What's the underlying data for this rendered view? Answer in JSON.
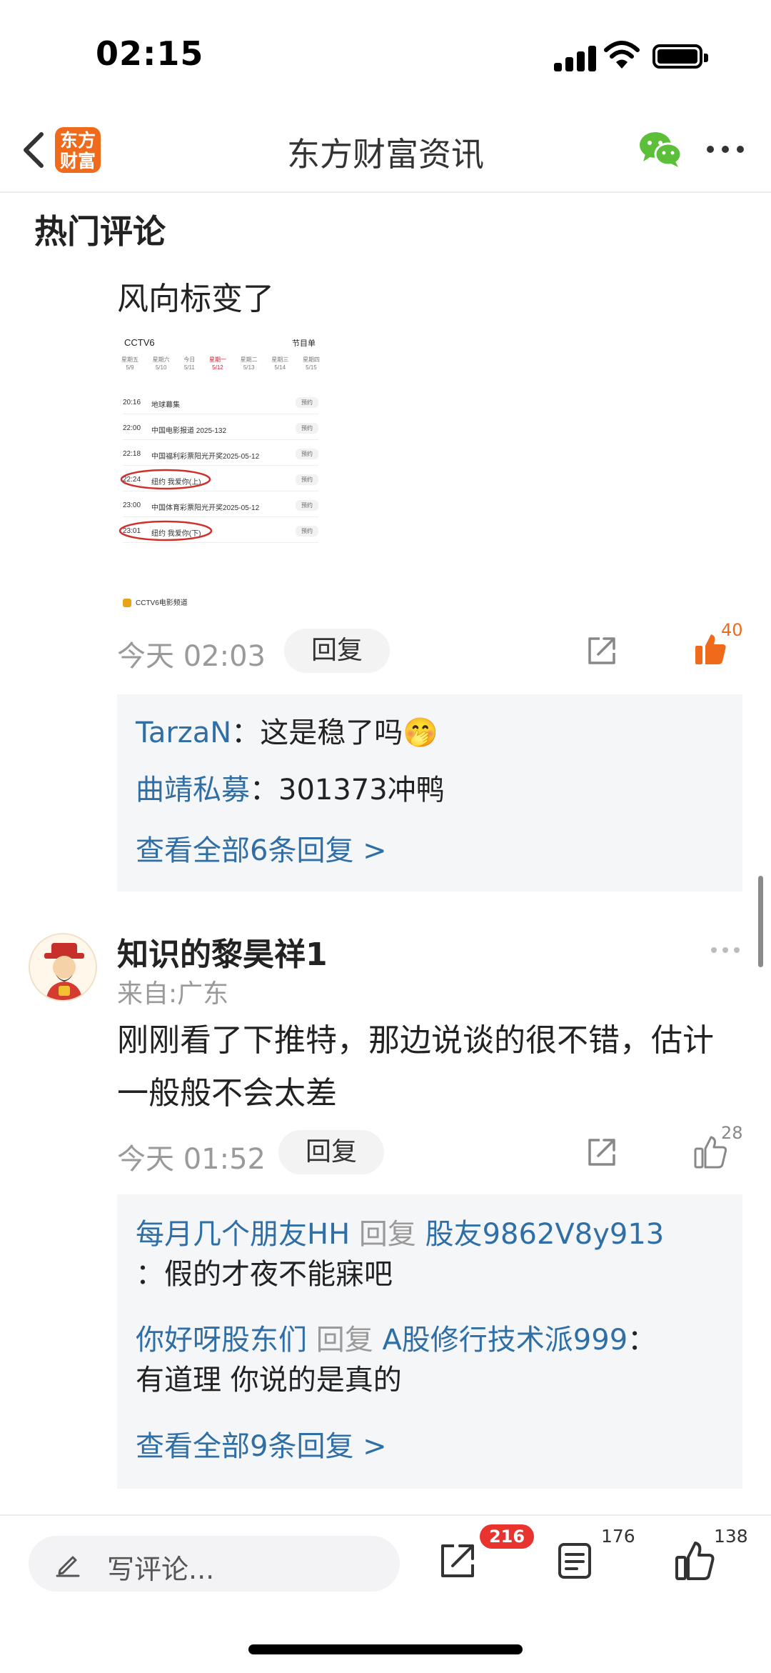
{
  "status_bar": {
    "time": "02:15"
  },
  "nav": {
    "logo_text": "东方财富",
    "title": "东方财富资讯",
    "share_icon": "wechat-icon",
    "more_icon": "more-icon"
  },
  "section_title": "热门评论",
  "comment1": {
    "text": "风向标变了",
    "screenshot": {
      "channel": "CCTV6",
      "program_list_label": "节目单",
      "days": [
        {
          "week": "星期五",
          "date": "5/9"
        },
        {
          "week": "星期六",
          "date": "5/10"
        },
        {
          "week": "今日",
          "date": "5/11"
        },
        {
          "week": "星期一",
          "date": "5/12"
        },
        {
          "week": "星期二",
          "date": "5/13"
        },
        {
          "week": "星期三",
          "date": "5/14"
        },
        {
          "week": "星期四",
          "date": "5/15"
        }
      ],
      "rows": [
        {
          "time": "20:16",
          "name": "地球幕集",
          "button": "预约"
        },
        {
          "time": "22:00",
          "name": "中国电影报道 2025-132",
          "button": "预约"
        },
        {
          "time": "22:18",
          "name": "中国福利彩票阳光开奖2025-05-12",
          "button": "预约"
        },
        {
          "time": "22:24",
          "name": "纽约 我爱你(上)",
          "button": "预约"
        },
        {
          "time": "23:00",
          "name": "中国体育彩票阳光开奖2025-05-12",
          "button": "预约"
        },
        {
          "time": "23:01",
          "name": "纽约 我爱你(下)",
          "button": "预约"
        }
      ],
      "footer": "CCTV6电影频道"
    },
    "time": "今天 02:03",
    "reply_label": "回复",
    "likes": "40",
    "replies": [
      {
        "user": "TarzaN",
        "sep": "：",
        "text": "这是稳了吗🤭"
      },
      {
        "user": "曲靖私募",
        "sep": "：",
        "text": "301373冲鸭"
      }
    ],
    "see_all": "查看全部6条回复 >"
  },
  "comment2": {
    "username": "知识的黎昊祥1",
    "from": "来自:广东",
    "text": "刚刚看了下推特，那边说谈的很不错，估计一般般不会太差",
    "time": "今天 01:52",
    "reply_label": "回复",
    "likes": "28",
    "replies": [
      {
        "user": "每月几个朋友HH",
        "reply_word": "回复",
        "target": "股友9862V8y913",
        "sep": "：",
        "text": "假的才夜不能寐吧"
      },
      {
        "user": "你好呀股东们",
        "reply_word": "回复",
        "target": "A股修行技术派999",
        "sep": "：",
        "text": "有道理 你说的是真的"
      }
    ],
    "see_all": "查看全部9条回复 >"
  },
  "bottom_bar": {
    "placeholder": "写评论...",
    "share_badge": "216",
    "comments_count": "176",
    "likes_count": "138"
  },
  "colors": {
    "accent": "#f06a1c",
    "link": "#2f6fa6",
    "badge": "#e8332f",
    "wechat": "#5bbf3a"
  }
}
